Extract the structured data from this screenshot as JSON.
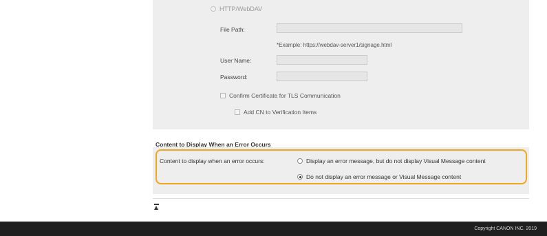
{
  "remote_settings": {
    "protocol_option": "HTTP/WebDAV",
    "file_path_label": "File Path:",
    "file_path_value": "",
    "file_path_example": "*Example: https://webdav-server1/signage.html",
    "user_name_label": "User Name:",
    "user_name_value": "",
    "password_label": "Password:",
    "password_value": "",
    "confirm_certificate_label": "Confirm Certificate for TLS Communication",
    "add_cn_label": "Add CN to Verification Items"
  },
  "error_section": {
    "title": "Content to Display When an Error Occurs",
    "field_label": "Content to display when an error occurs:",
    "options": [
      {
        "label": "Display an error message, but do not display Visual Message content",
        "selected": false
      },
      {
        "label": "Do not display an error message or Visual Message content",
        "selected": true
      }
    ]
  },
  "highlight_color": "#f0a81e",
  "top_link_icon": "back-to-top-icon",
  "footer": {
    "copyright": "Copyright CANON INC. 2019"
  }
}
